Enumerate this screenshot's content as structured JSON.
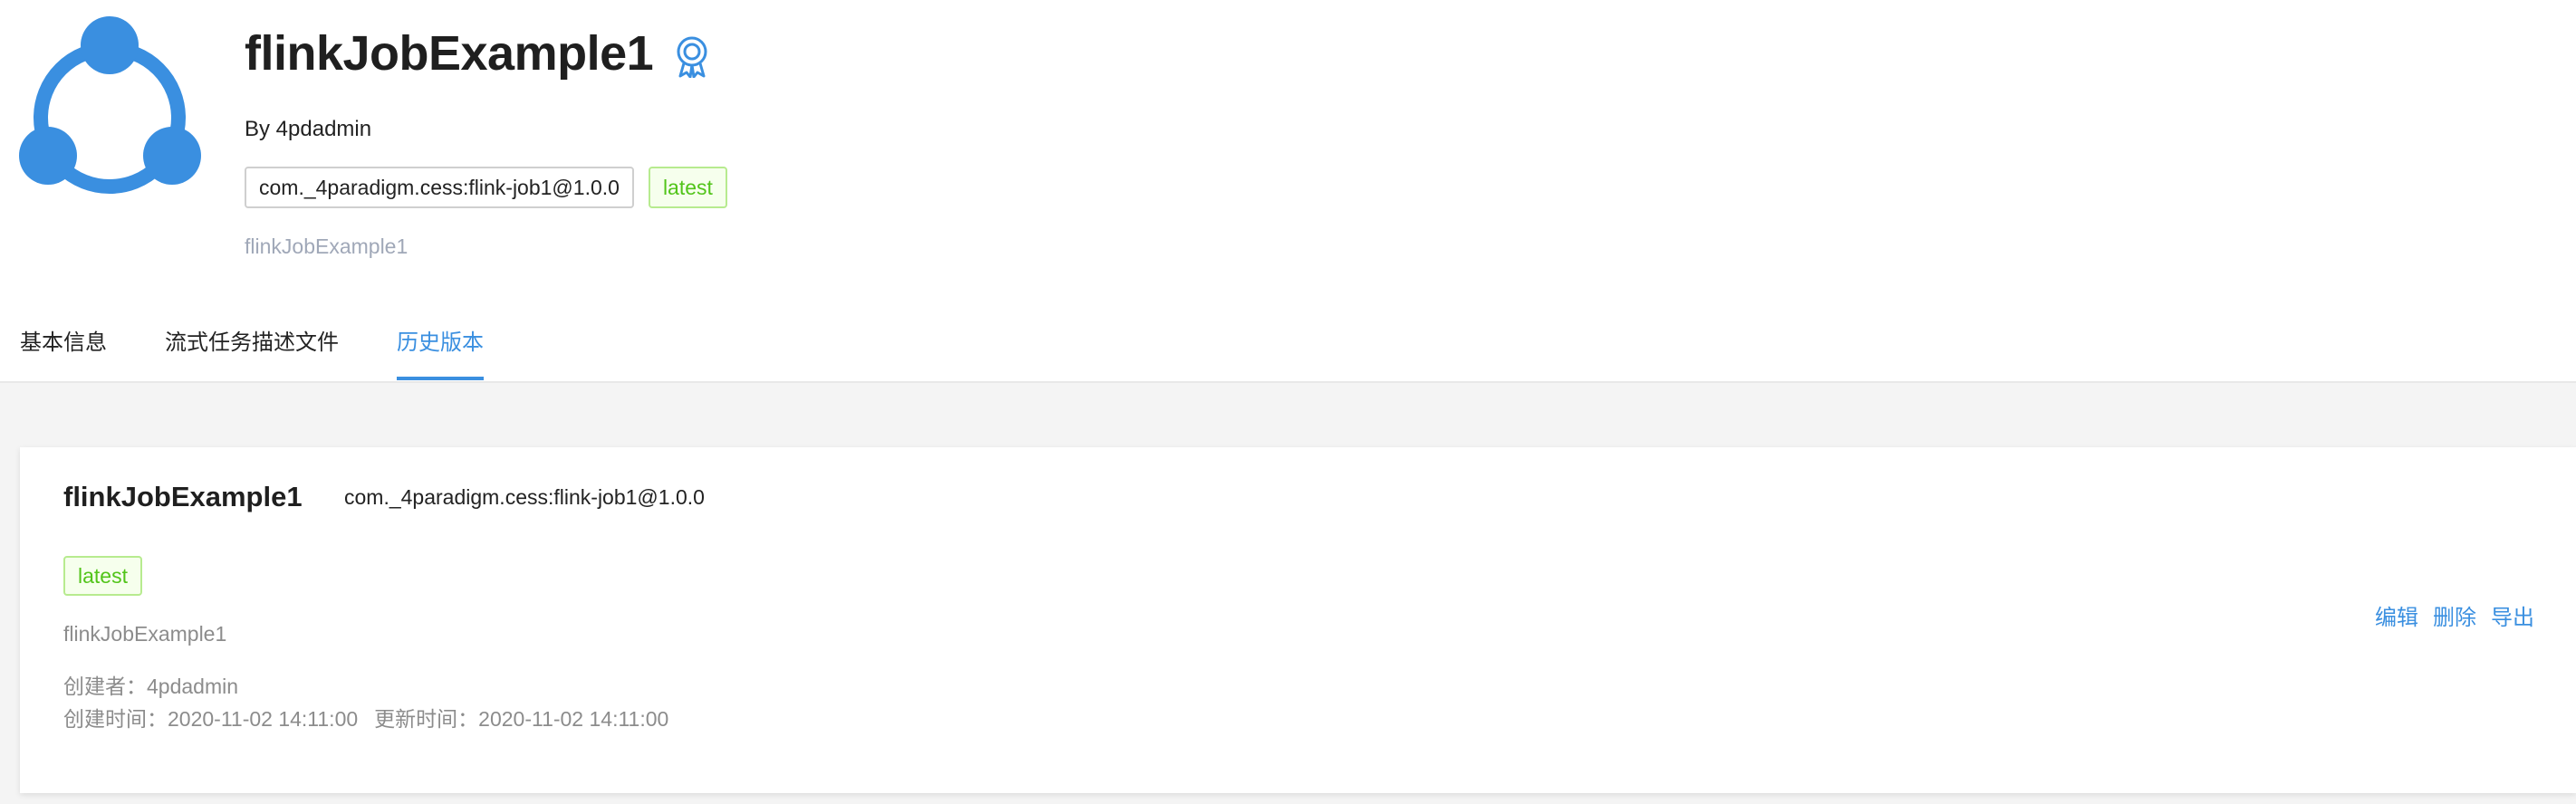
{
  "header": {
    "title": "flinkJobExample1",
    "author": "By 4pdadmin",
    "coordinate": "com._4paradigm.cess:flink-job1@1.0.0",
    "latest_tag": "latest",
    "description": "flinkJobExample1",
    "logo_icon": "share-nodes-icon",
    "badge_icon": "certified-badge-icon"
  },
  "tabs": [
    {
      "label": "基本信息",
      "active": false
    },
    {
      "label": "流式任务描述文件",
      "active": false
    },
    {
      "label": "历史版本",
      "active": true
    }
  ],
  "versions": [
    {
      "name": "flinkJobExample1",
      "coordinate": "com._4paradigm.cess:flink-job1@1.0.0",
      "tag": "latest",
      "description": "flinkJobExample1",
      "creator_label": "创建者：",
      "creator": "4pdadmin",
      "created_label": "创建时间：",
      "created_at": "2020-11-02 14:11:00",
      "updated_label": "更新时间：",
      "updated_at": "2020-11-02 14:11:00",
      "actions": {
        "edit": "编辑",
        "delete": "删除",
        "export": "导出"
      }
    }
  ],
  "colors": {
    "accent": "#3a8fe0",
    "tag_green": "#52c41a",
    "muted": "#8c8c8c",
    "page_bg": "#f4f4f4"
  }
}
